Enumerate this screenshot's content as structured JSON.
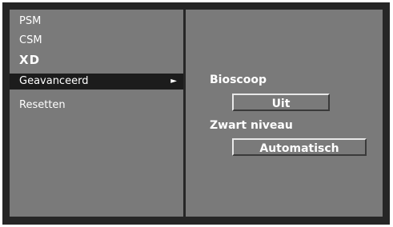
{
  "menu": {
    "items": [
      {
        "label": "PSM"
      },
      {
        "label": "CSM"
      },
      {
        "label": "XD"
      },
      {
        "label": "Geavanceerd",
        "arrow": "►"
      },
      {
        "label": "Resetten"
      }
    ],
    "selected_index": 3
  },
  "submenu": {
    "bioscoop_label": "Bioscoop",
    "bioscoop_value": "Uit",
    "zwart_niveau_label": "Zwart niveau",
    "zwart_niveau_value": "Automatisch"
  },
  "colors": {
    "frame": "#262626",
    "panel": "#7a7a7a",
    "selected": "#1c1c1c",
    "text": "#ffffff"
  },
  "icons": {
    "submenu_arrow": "right-triangle-icon"
  }
}
